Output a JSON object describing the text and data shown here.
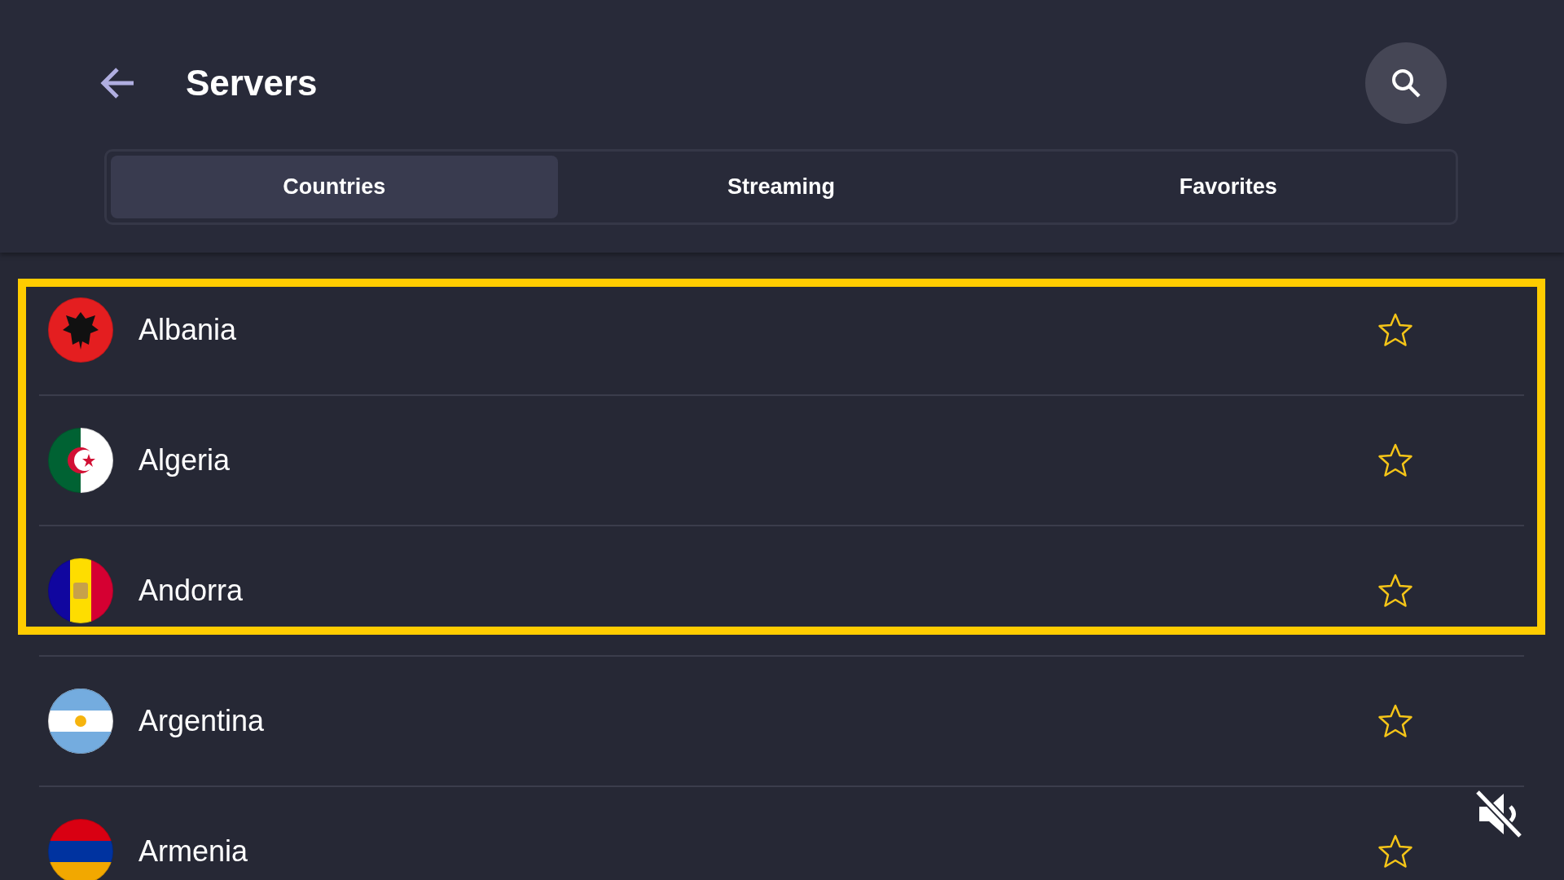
{
  "header": {
    "title": "Servers"
  },
  "tabs": [
    {
      "label": "Countries",
      "selected": true
    },
    {
      "label": "Streaming",
      "selected": false
    },
    {
      "label": "Favorites",
      "selected": false
    }
  ],
  "focused_countries": [
    {
      "name": "Albania",
      "kind": "albania",
      "favorite": false
    },
    {
      "name": "Algeria",
      "kind": "algeria",
      "favorite": false
    },
    {
      "name": "Andorra",
      "kind": "andorra",
      "favorite": false
    }
  ],
  "countries": [
    {
      "name": "Argentina",
      "kind": "argentina",
      "favorite": false
    },
    {
      "name": "Armenia",
      "kind": "armenia",
      "favorite": false
    }
  ],
  "sound": {
    "muted": true
  }
}
